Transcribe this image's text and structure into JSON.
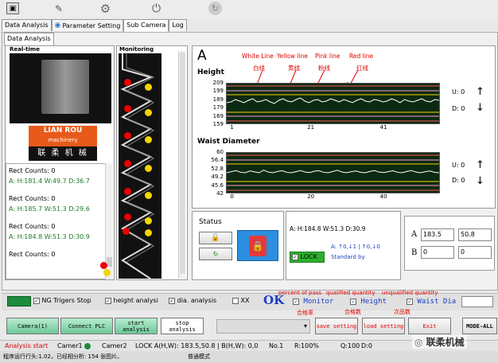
{
  "toolbar_tabs": [
    "Data Analysis",
    "Parameter Setting",
    "Sub Camera",
    "Log"
  ],
  "inner_tab": "Data Analysis",
  "realtime_label": "Real-time",
  "monitoring_label": "Monitoring",
  "logo": {
    "line1": "LIAN ROU",
    "line2": "machinery",
    "line3": "联 柔 机 械"
  },
  "rect_records": [
    {
      "count": "Rect Counts: 0",
      "val": "A: H:181.4 W:49.7 D:36.7"
    },
    {
      "count": "Rect Counts: 0",
      "val": "A: H:185.7 W:51.3 D:29.6"
    },
    {
      "count": "Rect Counts: 0",
      "val": "A: H:184.8 W:51.3 D:30.9"
    },
    {
      "count": "Rect Counts: 0",
      "val": ""
    }
  ],
  "big_letter": "A",
  "annotations": {
    "white_line": "White Line",
    "white_cn": "白线",
    "yellow_line": "Yellow line",
    "yellow_cn": "黄线",
    "pink_line": "Pink line",
    "pink_cn": "粉线",
    "red_line": "Red line",
    "red_cn": "红线"
  },
  "height_chart": {
    "title": "Height",
    "yticks": [
      "209",
      "199",
      "189",
      "179",
      "169",
      "159"
    ],
    "xticks": [
      "1",
      "21",
      "41"
    ],
    "u": "U: 0",
    "d": "D: 0"
  },
  "waist_chart": {
    "title": "Waist Diameter",
    "yticks": [
      "60",
      "56.4",
      "52.8",
      "49.2",
      "45.6",
      "42"
    ],
    "xticks": [
      "0",
      "20",
      "40"
    ],
    "u": "U: 0",
    "d": "D: 0"
  },
  "chart_data": [
    {
      "type": "line",
      "title": "Height",
      "ylim": [
        159,
        209
      ],
      "series": [
        {
          "values": [
            185,
            186,
            189,
            187,
            185,
            188,
            190,
            186,
            187,
            189,
            186,
            184,
            188,
            190,
            187,
            186,
            189,
            191,
            187,
            185,
            188,
            189,
            186,
            187,
            190,
            188,
            186,
            189,
            187,
            185,
            188,
            190,
            187,
            186,
            189,
            188,
            186,
            187,
            190,
            188,
            185,
            189,
            187,
            186,
            188,
            190,
            187,
            186,
            189,
            188
          ]
        }
      ]
    },
    {
      "type": "line",
      "title": "Waist Diameter",
      "ylim": [
        42,
        60
      ],
      "series": [
        {
          "values": [
            51,
            51.5,
            52,
            51.2,
            51,
            51.8,
            51.4,
            51,
            52.2,
            51.3,
            51,
            51.6,
            51.9,
            51.2,
            51,
            51.5,
            52,
            51.3,
            51.1,
            51.7,
            51.9,
            51.2,
            51,
            51.6,
            52.1,
            51.3,
            51,
            51.5,
            51.8,
            51.2,
            51,
            51.6,
            52,
            51.3,
            51.1,
            51.5,
            51.9,
            51.2,
            51,
            51.6,
            52,
            51.3,
            51,
            51.5,
            51.8,
            51.2,
            51
          ]
        }
      ]
    }
  ],
  "status": {
    "title": "Status",
    "measure": "A: H:184.8 W:51.3 D:30.9",
    "arrows": "A: ↑0,↓1 | ↑0,↓0",
    "lock": "LOCK",
    "standard": "Standard by"
  },
  "standard_values": {
    "a_label": "A",
    "b_label": "B",
    "a1": "183.5",
    "a2": "50.8",
    "b1": "0",
    "b2": "0"
  },
  "bottom_annotations": {
    "pass_rate": "percent of pass",
    "pass_rate_cn": "合格率",
    "qualified": "qualified quantity",
    "qualified_cn": "合格数",
    "unqualified": "unqualified quantity",
    "unqualified_cn": "次品数"
  },
  "options": {
    "ng_trig": "NG Trigers Stop",
    "height_analysis": "height analysi",
    "dia_analysis": "dia. analysis",
    "xx": "XX",
    "ok": "OK",
    "monitor": "Monitor",
    "height": "Height",
    "waist": "Waist Dia"
  },
  "buttons": {
    "camera": "Camera(1)",
    "plc": "Connect PLC",
    "start": "start analysis",
    "stop": "stop analysis",
    "save": "save setting",
    "load": "load setting",
    "exit": "Exit",
    "mode": "MODE-ALL"
  },
  "statusbar": {
    "analysis": "Analysis start",
    "cam1": "Camer1",
    "cam2": "Camer2",
    "lock": "LOCK A(H,W): 183.5,50.8 | B(H,W): 0,0",
    "no": "No.1",
    "rate": "R:100%",
    "q": "Q:100",
    "d": "D:0",
    "runtime": "程序运行行头:1.02，已经相分析: 154 张图片。",
    "mode": "普通模式"
  },
  "watermark": "联柔机械",
  "colors": {
    "accent_red": "#e00000",
    "accent_blue": "#1b3ec4",
    "plot_bg": "#0c2a12",
    "lock_green": "#2bb02b"
  }
}
